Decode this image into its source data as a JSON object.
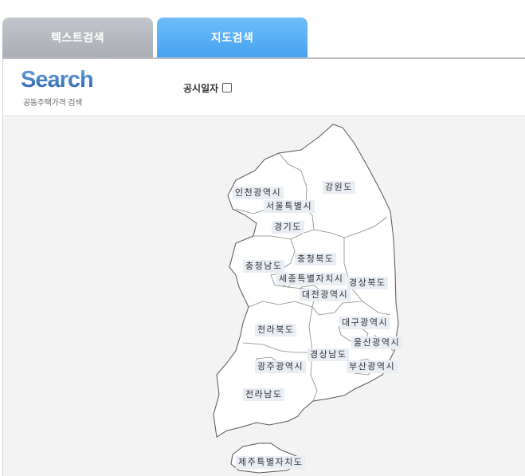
{
  "tabs": {
    "text_search": "텍스트검색",
    "map_search": "지도검색"
  },
  "search": {
    "logo": "Search",
    "logo_sub": "공동주택가격 검색",
    "date_label": "공시일자"
  },
  "map": {
    "regions": {
      "incheon": "인천광역시",
      "gangwon": "강원도",
      "seoul": "서울특별시",
      "gyeonggi": "경기도",
      "chungbuk": "충청북도",
      "chungnam": "충청남도",
      "sejong": "세종특별자치시",
      "gyeongbuk": "경상북도",
      "daejeon": "대전광역시",
      "daegu": "대구광역시",
      "jeonbuk": "전라북도",
      "ulsan": "울산광역시",
      "gyeongnam": "경상남도",
      "gwangju": "광주광역시",
      "busan": "부산광역시",
      "jeonnam": "전라남도",
      "jeju": "제주특별자치도"
    }
  }
}
